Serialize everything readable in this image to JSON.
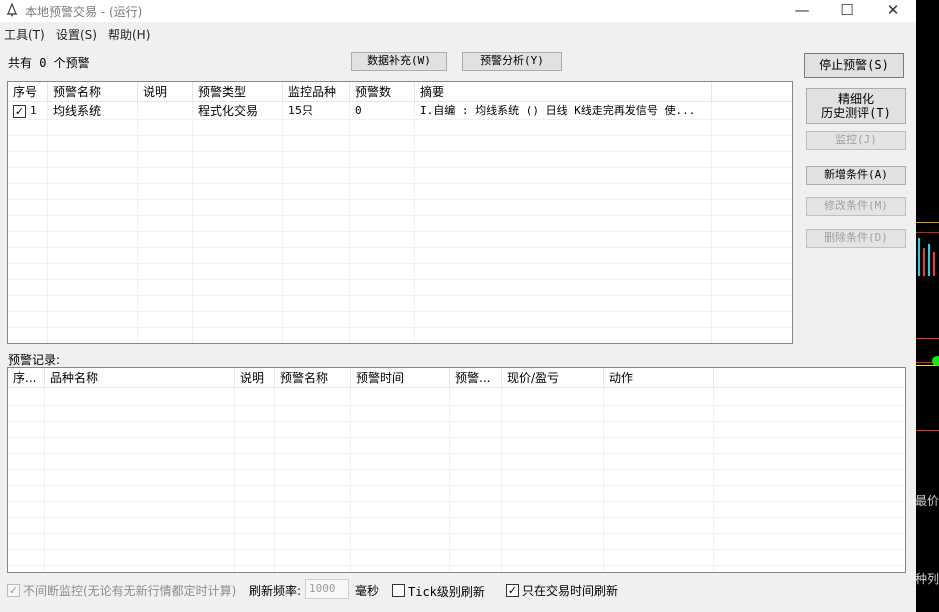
{
  "window": {
    "title": "本地预警交易  -  (运行)",
    "minimize_glyph": "—",
    "maximize_glyph": "☐",
    "close_glyph": "✕"
  },
  "menu": [
    "工具(T)",
    "设置(S)",
    "帮助(H)"
  ],
  "summary_label": "共有 0 个预警",
  "top_buttons": {
    "data_fill": "数据补充(W)",
    "analysis": "预警分析(Y)"
  },
  "side_buttons": {
    "stop": "停止预警(S)",
    "refine_line1": "精细化",
    "refine_line2": "历史测评(T)",
    "monitor": "监控(J)",
    "add_condition": "新增条件(A)",
    "edit_condition": "修改条件(M)",
    "delete_condition": "删除条件(D)"
  },
  "alerts_table": {
    "columns": [
      "序号",
      "预警名称",
      "说明",
      "预警类型",
      "监控品种",
      "预警数",
      "摘要"
    ],
    "rows": [
      {
        "checked": true,
        "index": "1",
        "name": "均线系统",
        "description": "",
        "type": "程式化交易",
        "varieties": "15只",
        "count": "0",
        "summary": "I.自编 : 均线系统 () 日线 K线走完再发信号 使..."
      }
    ]
  },
  "records_label": "预警记录:",
  "records_table": {
    "columns": [
      "序...",
      "品种名称",
      "说明",
      "预警名称",
      "预警时间",
      "预警...",
      "现价/盈亏",
      "动作"
    ],
    "rows": []
  },
  "footer": {
    "continuous_monitor_label": "不间断监控(无论有无新行情都定时计算)",
    "continuous_monitor_checked": true,
    "refresh_rate_label": "刷新频率:",
    "refresh_rate_value": "1000",
    "ms_label": "毫秒",
    "tick_refresh_label": "Tick级别刷新",
    "tick_refresh_checked": false,
    "trade_time_label": "只在交易时间刷新",
    "trade_time_checked": true
  },
  "background_app": {
    "price_label": "最价",
    "variety_label": "品种列"
  },
  "colors": {
    "window_bg": "#f0f0f0",
    "titlebar_bg": "#ffffff",
    "background_app_bg": "#000000",
    "chart_red": "#ff2020",
    "chart_cyan": "#19d6e6",
    "chart_green": "#17e617",
    "chart_yellow": "#e6e619"
  }
}
